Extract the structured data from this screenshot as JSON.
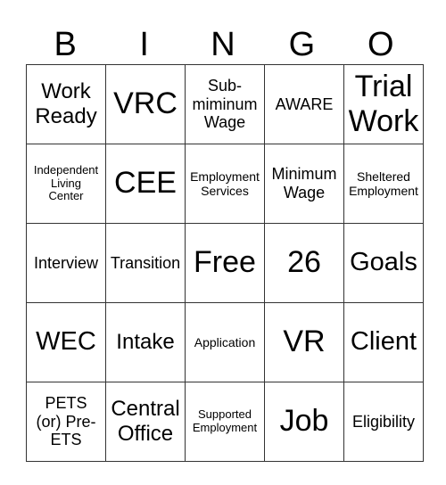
{
  "header": [
    "B",
    "I",
    "N",
    "G",
    "O"
  ],
  "grid": [
    [
      "Work Ready",
      "VRC",
      "Sub-\nmiminum\nWage",
      "AWARE",
      "Trial Work"
    ],
    [
      "Independent\nLiving\nCenter",
      "CEE",
      "Employment\nServices",
      "Minimum\nWage",
      "Sheltered\nEmployment"
    ],
    [
      "Interview",
      "Transition",
      "Free",
      "26",
      "Goals"
    ],
    [
      "WEC",
      "Intake",
      "Application",
      "VR",
      "Client"
    ],
    [
      "PETS\n(or) Pre-\nETS",
      "Central\nOffice",
      "Supported\nEmployment",
      "Job",
      "Eligibility"
    ]
  ]
}
